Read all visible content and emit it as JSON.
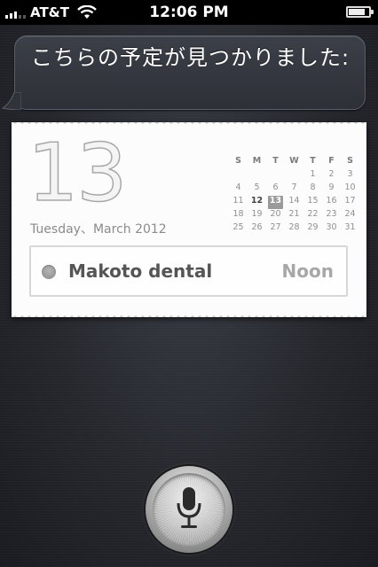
{
  "status_bar": {
    "carrier": "AT&T",
    "time": "12:06 PM",
    "battery_level": 0.8
  },
  "siri": {
    "response_text": "こちらの予定が見つかりました:"
  },
  "calendar": {
    "day_number": "13",
    "date_line": "Tuesday、March 2012",
    "weekday_headers": [
      "S",
      "M",
      "T",
      "W",
      "T",
      "F",
      "S"
    ],
    "days": [
      "",
      "",
      "",
      "",
      "1",
      "2",
      "3",
      "4",
      "5",
      "6",
      "7",
      "8",
      "9",
      "10",
      "11",
      "12",
      "13",
      "14",
      "15",
      "16",
      "17",
      "18",
      "19",
      "20",
      "21",
      "22",
      "23",
      "24",
      "25",
      "26",
      "27",
      "28",
      "29",
      "30",
      "31"
    ],
    "highlighted_day": "13",
    "bold_day": "12",
    "event": {
      "title": "Makoto dental",
      "time": "Noon"
    }
  },
  "mic_button": {
    "icon": "microphone-icon"
  },
  "colors": {
    "background": "#25272d",
    "card": "#fcfcfc",
    "today_highlight": "#9a9a9a"
  }
}
